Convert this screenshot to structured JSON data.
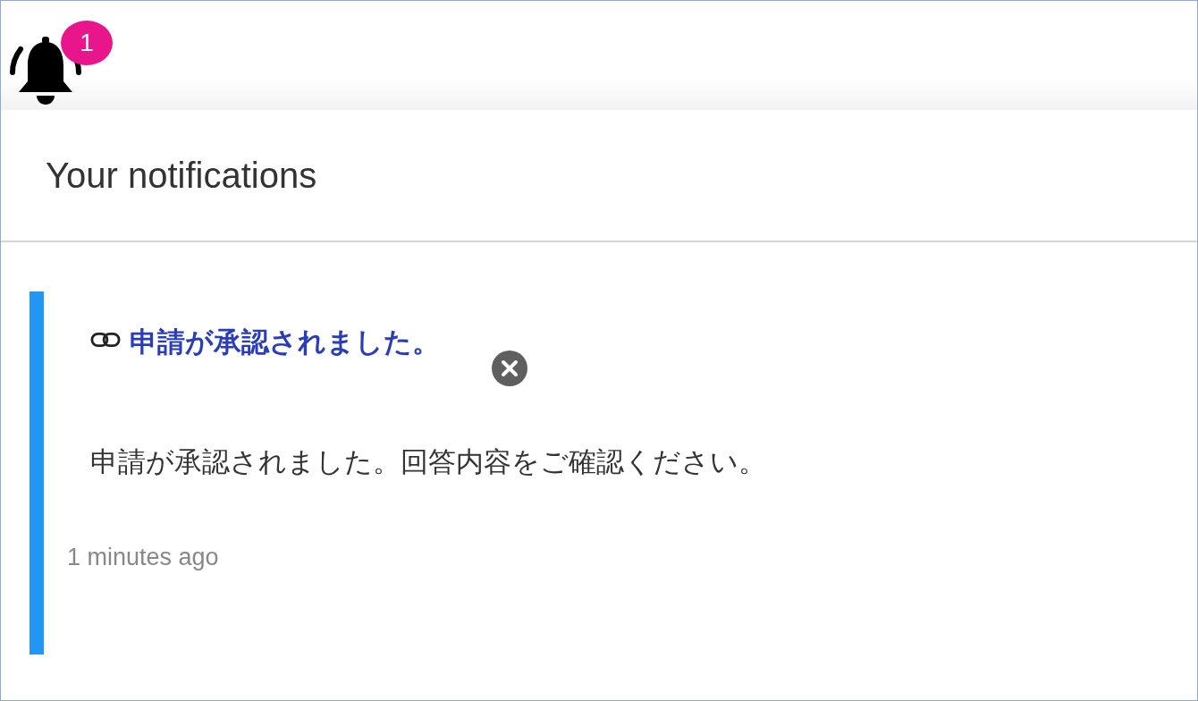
{
  "bell": {
    "badge": "1"
  },
  "panel": {
    "title": "Your notifications"
  },
  "notifications": [
    {
      "title": "申請が承認されました。",
      "message": "申請が承認されました。回答内容をご確認ください。",
      "time": "1 minutes ago"
    }
  ]
}
